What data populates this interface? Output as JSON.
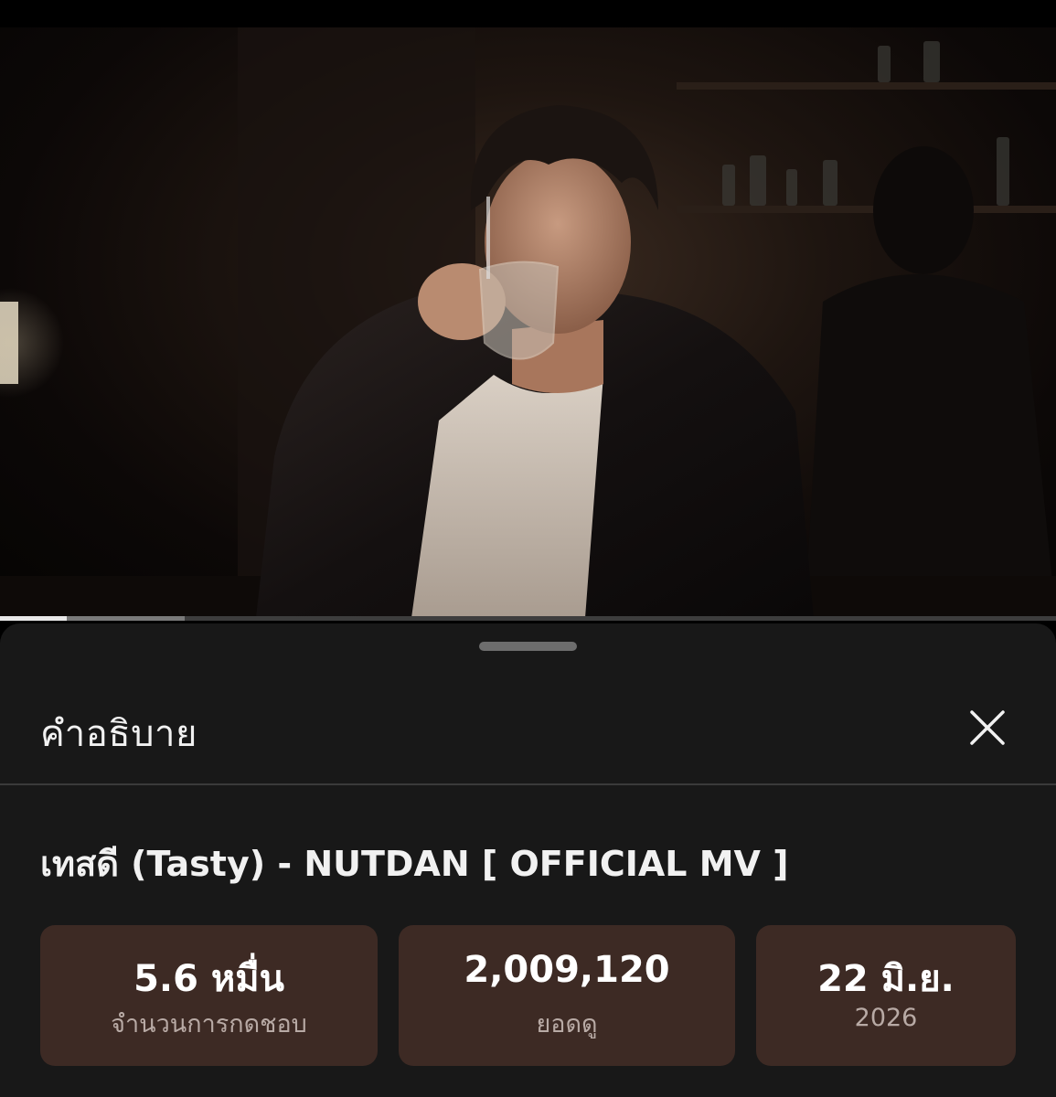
{
  "panel": {
    "heading": "คำอธิบาย"
  },
  "video": {
    "title": "เทสดี (Tasty) - NUTDAN [ OFFICIAL MV ]",
    "progress_played": 0.063,
    "progress_buffered": 0.175
  },
  "stats": {
    "likes": {
      "value": "5.6 หมื่น",
      "label": "จำนวนการกดชอบ"
    },
    "views": {
      "value": "2,009,120",
      "label": "ยอดดู"
    },
    "date": {
      "value": "22 มิ.ย.",
      "label": "2026"
    }
  },
  "icons": {
    "close": "close-icon"
  },
  "colors": {
    "sheet_background": "#181818",
    "card_background": "#3d2a24",
    "primary_text": "#f1f1f1",
    "secondary_text": "#b8aaa5"
  }
}
